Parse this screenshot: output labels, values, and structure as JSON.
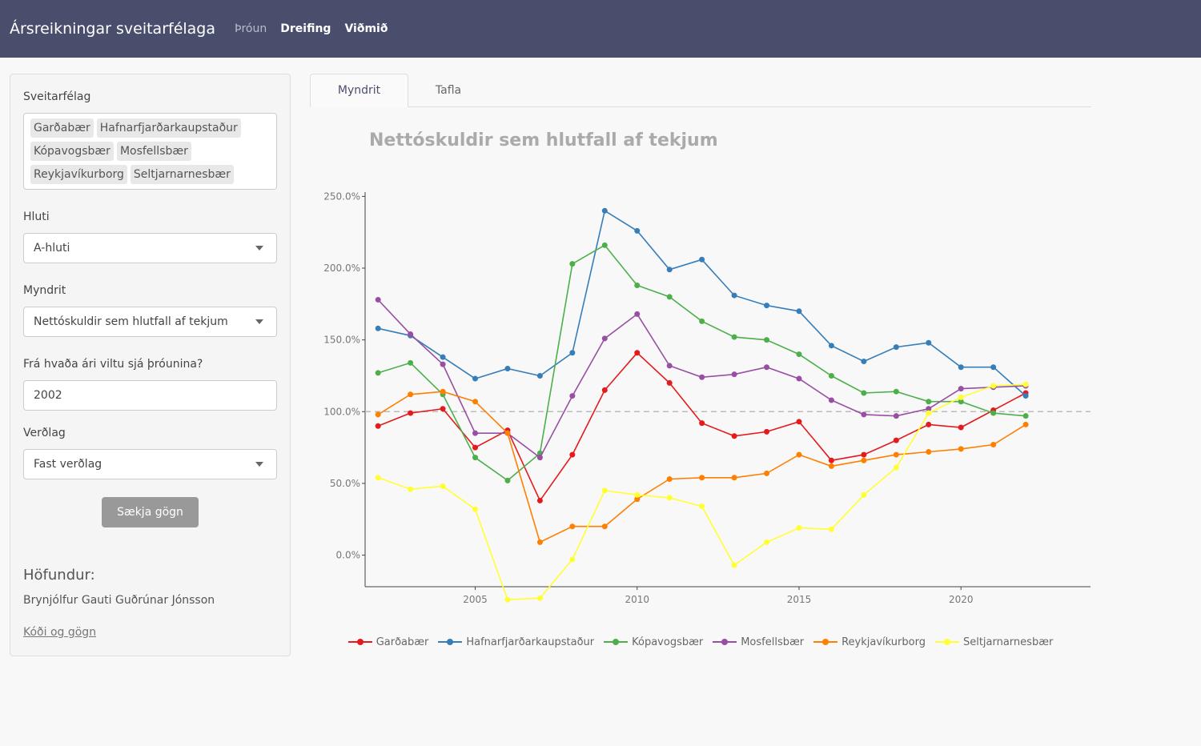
{
  "navbar": {
    "title": "Ársreikningar sveitarfélaga",
    "links": [
      "Þróun",
      "Dreifing",
      "Viðmið"
    ]
  },
  "sidebar": {
    "municipality_label": "Sveitarfélag",
    "municipalities": [
      "Garðabær",
      "Hafnarfjarðarkaupstaður",
      "Kópavogsbær",
      "Mosfellsbær",
      "Reykjavíkurborg",
      "Seltjarnarnesbær"
    ],
    "part_label": "Hluti",
    "part_value": "A-hluti",
    "chart_label": "Myndrit",
    "chart_value": "Nettóskuldir sem hlutfall af tekjum",
    "year_label": "Frá hvaða ári viltu sjá þróunina?",
    "year_value": "2002",
    "price_label": "Verðlag",
    "price_value": "Fast verðlag",
    "fetch_button": "Sækja gögn",
    "author_heading": "Höfundur:",
    "author_name": "Brynjólfur Gauti Guðrúnar Jónsson",
    "code_link": "Kóði og gögn"
  },
  "tabs": [
    "Myndrit",
    "Tafla"
  ],
  "colors": {
    "navbar": "#4a4e6d",
    "series": [
      "#e41a1c",
      "#377eb8",
      "#4daf4a",
      "#984ea3",
      "#ff7f00",
      "#ffff33"
    ]
  },
  "chart_data": {
    "type": "line",
    "title": "Nettóskuldir sem hlutfall af tekjum",
    "xlabel": "",
    "ylabel": "",
    "x": [
      2002,
      2003,
      2004,
      2005,
      2006,
      2007,
      2008,
      2009,
      2010,
      2011,
      2012,
      2013,
      2014,
      2015,
      2016,
      2017,
      2018,
      2019,
      2020,
      2021,
      2022
    ],
    "xticks": [
      "2005",
      "2010",
      "2015",
      "2020"
    ],
    "yticks": [
      "0.0%",
      "50.0%",
      "100.0%",
      "150.0%",
      "200.0%",
      "250.0%"
    ],
    "xlim": [
      2001.6,
      2024.0
    ],
    "ylim": [
      -22,
      253
    ],
    "reference_line": 100,
    "legend_position": "bottom",
    "series": [
      {
        "name": "Garðabær",
        "values": [
          90,
          99,
          102,
          75,
          87,
          38,
          70,
          115,
          141,
          120,
          92,
          83,
          86,
          93,
          66,
          70,
          80,
          91,
          89,
          101,
          113
        ]
      },
      {
        "name": "Hafnarfjarðarkaupstaður",
        "values": [
          158,
          153,
          138,
          123,
          130,
          125,
          141,
          240,
          226,
          199,
          206,
          181,
          174,
          170,
          146,
          135,
          145,
          148,
          131,
          131,
          111
        ]
      },
      {
        "name": "Kópavogsbær",
        "values": [
          127,
          134,
          112,
          68,
          52,
          71,
          203,
          216,
          188,
          180,
          163,
          152,
          150,
          140,
          125,
          113,
          114,
          107,
          107,
          99,
          97
        ]
      },
      {
        "name": "Mosfellsbær",
        "values": [
          178,
          154,
          133,
          85,
          85,
          68,
          111,
          151,
          168,
          132,
          124,
          126,
          131,
          123,
          108,
          98,
          97,
          102,
          116,
          117,
          118
        ]
      },
      {
        "name": "Reykjavíkurborg",
        "values": [
          98,
          112,
          114,
          107,
          85,
          9,
          20,
          20,
          39,
          53,
          54,
          54,
          57,
          70,
          62,
          66,
          70,
          72,
          74,
          77,
          91
        ]
      },
      {
        "name": "Seltjarnarnesbær",
        "values": [
          54,
          46,
          48,
          32,
          -31,
          -30,
          -3,
          45,
          42,
          40,
          34,
          -7,
          9,
          19,
          18,
          42,
          61,
          99,
          110,
          118,
          119
        ]
      }
    ]
  }
}
